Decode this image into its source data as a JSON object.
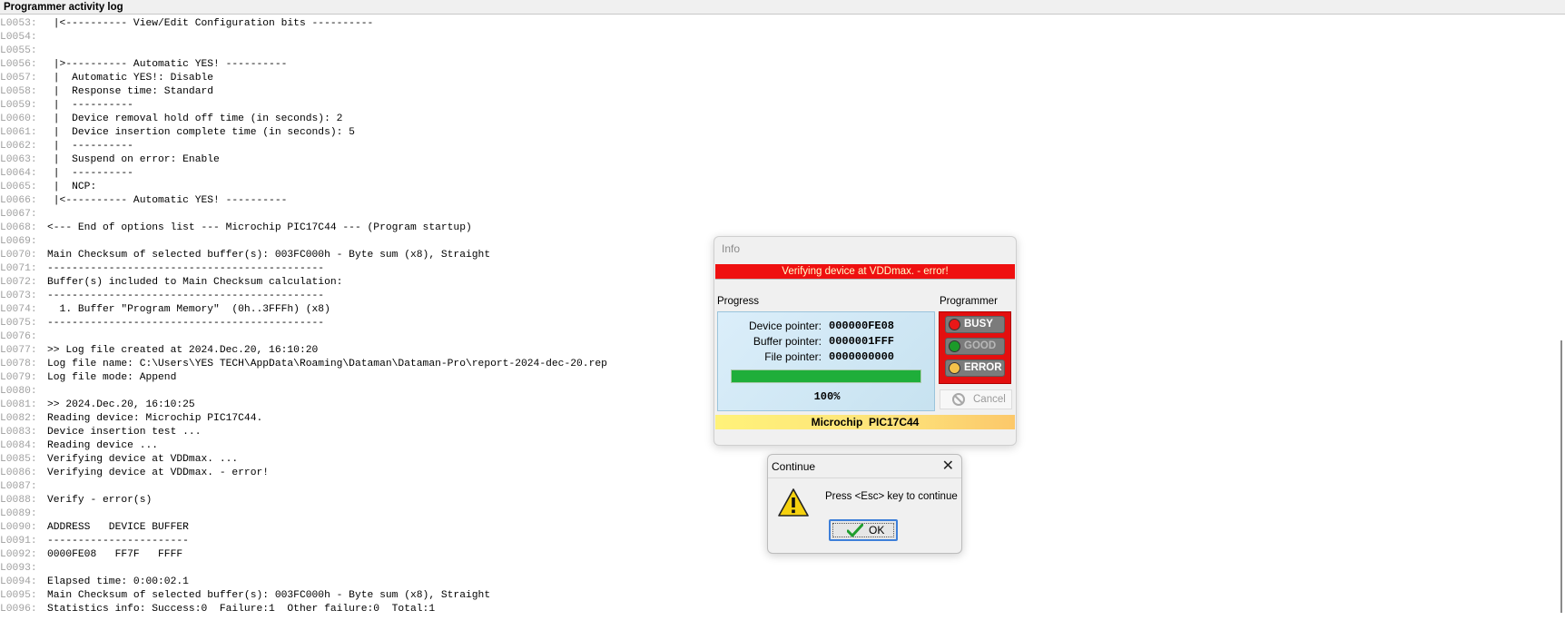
{
  "window": {
    "title": "Programmer activity log"
  },
  "log": [
    {
      "n": "L0053:",
      "t": " |<---------- View/Edit Configuration bits ----------"
    },
    {
      "n": "L0054:",
      "t": ""
    },
    {
      "n": "L0055:",
      "t": ""
    },
    {
      "n": "L0056:",
      "t": " |>---------- Automatic YES! ----------"
    },
    {
      "n": "L0057:",
      "t": " |  Automatic YES!: Disable"
    },
    {
      "n": "L0058:",
      "t": " |  Response time: Standard"
    },
    {
      "n": "L0059:",
      "t": " |  ----------"
    },
    {
      "n": "L0060:",
      "t": " |  Device removal hold off time (in seconds): 2"
    },
    {
      "n": "L0061:",
      "t": " |  Device insertion complete time (in seconds): 5"
    },
    {
      "n": "L0062:",
      "t": " |  ----------"
    },
    {
      "n": "L0063:",
      "t": " |  Suspend on error: Enable"
    },
    {
      "n": "L0064:",
      "t": " |  ----------"
    },
    {
      "n": "L0065:",
      "t": " |  NCP:"
    },
    {
      "n": "L0066:",
      "t": " |<---------- Automatic YES! ----------"
    },
    {
      "n": "L0067:",
      "t": ""
    },
    {
      "n": "L0068:",
      "t": "<--- End of options list --- Microchip PIC17C44 --- (Program startup)"
    },
    {
      "n": "L0069:",
      "t": ""
    },
    {
      "n": "L0070:",
      "t": "Main Checksum of selected buffer(s): 003FC000h - Byte sum (x8), Straight"
    },
    {
      "n": "L0071:",
      "t": "---------------------------------------------"
    },
    {
      "n": "L0072:",
      "t": "Buffer(s) included to Main Checksum calculation:"
    },
    {
      "n": "L0073:",
      "t": "---------------------------------------------"
    },
    {
      "n": "L0074:",
      "t": "  1. Buffer \"Program Memory\"  (0h..3FFFh) (x8)"
    },
    {
      "n": "L0075:",
      "t": "---------------------------------------------"
    },
    {
      "n": "L0076:",
      "t": ""
    },
    {
      "n": "L0077:",
      "t": ">> Log file created at 2024.Dec.20, 16:10:20"
    },
    {
      "n": "L0078:",
      "t": "Log file name: C:\\Users\\YES TECH\\AppData\\Roaming\\Dataman\\Dataman-Pro\\report-2024-dec-20.rep"
    },
    {
      "n": "L0079:",
      "t": "Log file mode: Append"
    },
    {
      "n": "L0080:",
      "t": ""
    },
    {
      "n": "L0081:",
      "t": ">> 2024.Dec.20, 16:10:25"
    },
    {
      "n": "L0082:",
      "t": "Reading device: Microchip PIC17C44."
    },
    {
      "n": "L0083:",
      "t": "Device insertion test ..."
    },
    {
      "n": "L0084:",
      "t": "Reading device ..."
    },
    {
      "n": "L0085:",
      "t": "Verifying device at VDDmax. ..."
    },
    {
      "n": "L0086:",
      "t": "Verifying device at VDDmax. - error!"
    },
    {
      "n": "L0087:",
      "t": ""
    },
    {
      "n": "L0088:",
      "t": "Verify - error(s)"
    },
    {
      "n": "L0089:",
      "t": ""
    },
    {
      "n": "L0090:",
      "t": "ADDRESS   DEVICE BUFFER"
    },
    {
      "n": "L0091:",
      "t": "-----------------------"
    },
    {
      "n": "L0092:",
      "t": "0000FE08   FF7F   FFFF"
    },
    {
      "n": "L0093:",
      "t": ""
    },
    {
      "n": "L0094:",
      "t": "Elapsed time: 0:00:02.1"
    },
    {
      "n": "L0095:",
      "t": "Main Checksum of selected buffer(s): 003FC000h - Byte sum (x8), Straight"
    },
    {
      "n": "L0096:",
      "t": "Statistics info: Success:0  Failure:1  Other failure:0  Total:1"
    }
  ],
  "info_dialog": {
    "title": "Info",
    "banner": "Verifying device at VDDmax. - error!",
    "progress_label": "Progress",
    "programmer_label": "Programmer",
    "device_pointer_label": "Device pointer:",
    "device_pointer_value": "000000FE08",
    "buffer_pointer_label": "Buffer pointer:",
    "buffer_pointer_value": "0000001FFF",
    "file_pointer_label": "File pointer:",
    "file_pointer_value": "0000000000",
    "progress_percent": "100%",
    "progress_fraction": 1.0,
    "indicators": [
      {
        "label": "BUSY",
        "dot_color": "#e81818",
        "text_color": "#ffffff"
      },
      {
        "label": "GOOD",
        "dot_color": "#1c9a2a",
        "text_color": "#b8b8b8"
      },
      {
        "label": "ERROR",
        "dot_color": "#f4c14a",
        "text_color": "#ffffff"
      }
    ],
    "cancel_label": "Cancel",
    "device_name": "Microchip  PIC17C44"
  },
  "continue_dialog": {
    "title": "Continue",
    "close_glyph": "✕",
    "message": "Press <Esc> key to continue",
    "ok_label": "OK"
  }
}
